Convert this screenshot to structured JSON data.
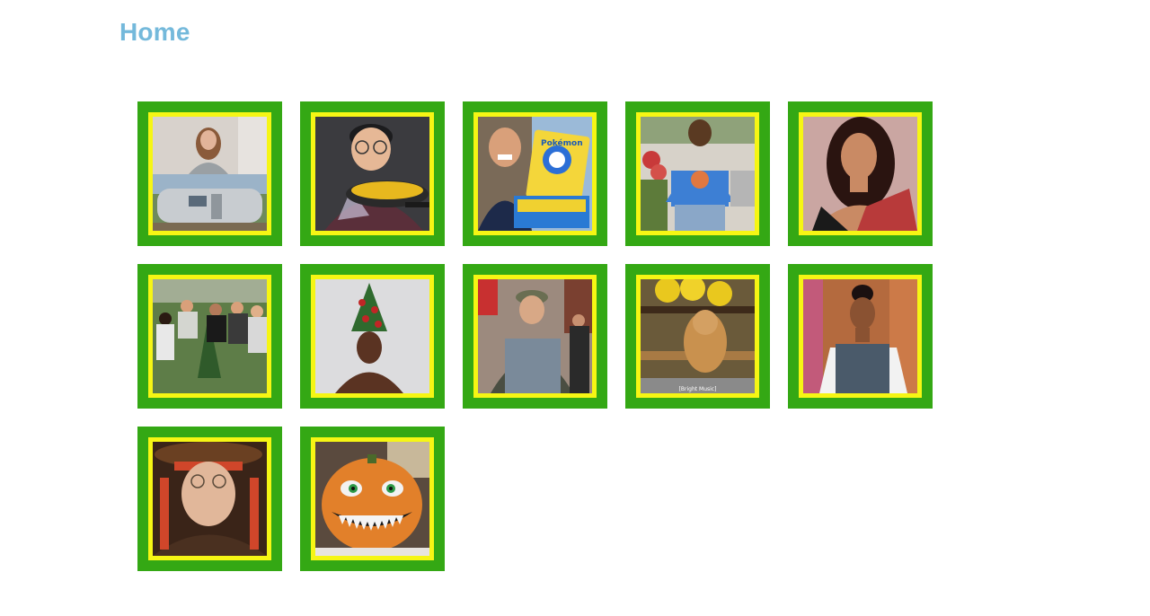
{
  "header": {
    "title": "Home"
  },
  "tiles": [
    {
      "icon": "woman-airstream-thumbnail"
    },
    {
      "icon": "man-cooking-thumbnail"
    },
    {
      "icon": "pokemon-cards-thumbnail",
      "caption": "Pokémon"
    },
    {
      "icon": "man-blue-shirt-thumbnail"
    },
    {
      "icon": "woman-portrait-thumbnail"
    },
    {
      "icon": "group-tree-thumbnail"
    },
    {
      "icon": "headdress-thumbnail"
    },
    {
      "icon": "hiker-thumbnail"
    },
    {
      "icon": "chipmunk-thumbnail",
      "caption": "[Bright Music]"
    },
    {
      "icon": "woman-mural-thumbnail"
    },
    {
      "icon": "pirate-man-thumbnail"
    },
    {
      "icon": "pumpkin-thumbnail"
    }
  ],
  "colors": {
    "title": "#74b9db",
    "tile_border": "#34a814",
    "tile_frame": "#f6f614"
  }
}
